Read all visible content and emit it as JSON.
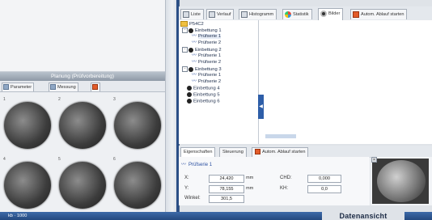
{
  "left_panel": {
    "header": "Planung (Prüfvorbereitung)",
    "tabs": [
      {
        "label": "Parameter",
        "icon": "parameter-icon"
      },
      {
        "label": "Messung",
        "icon": "measure-icon"
      },
      {
        "label": "",
        "icon": "image-icon"
      }
    ],
    "samples": [
      {
        "index": "1"
      },
      {
        "index": "2"
      },
      {
        "index": "3"
      },
      {
        "index": "4"
      },
      {
        "index": "5"
      },
      {
        "index": "6"
      }
    ]
  },
  "top_right": {
    "tabs": [
      {
        "label": "Liste",
        "icon": "list-icon"
      },
      {
        "label": "Verlauf",
        "icon": "history-icon"
      },
      {
        "label": "Histogramm",
        "icon": "histogram-icon"
      },
      {
        "label": "Statistik",
        "icon": "statistics-icon"
      },
      {
        "label": "Bilder",
        "icon": "images-icon",
        "active": true
      },
      {
        "label": "Autom. Ablauf starten",
        "icon": "autorun-icon"
      }
    ],
    "tree": [
      {
        "label": "P54C2",
        "level": 0,
        "type": "folder"
      },
      {
        "label": "Einbettung 1",
        "level": 1,
        "type": "group",
        "expand": "−"
      },
      {
        "label": "Prüfserie 1",
        "level": 2,
        "type": "series",
        "selected": true
      },
      {
        "label": "Prüfserie 2",
        "level": 2,
        "type": "series"
      },
      {
        "label": "Einbettung 2",
        "level": 1,
        "type": "group",
        "expand": "−"
      },
      {
        "label": "Prüfserie 1",
        "level": 2,
        "type": "series"
      },
      {
        "label": "Prüfserie 2",
        "level": 2,
        "type": "series"
      },
      {
        "label": "Einbettung 3",
        "level": 1,
        "type": "group",
        "expand": "−"
      },
      {
        "label": "Prüfserie 1",
        "level": 2,
        "type": "series"
      },
      {
        "label": "Prüfserie 2",
        "level": 2,
        "type": "series"
      },
      {
        "label": "Einbettung 4",
        "level": 1,
        "type": "group"
      },
      {
        "label": "Einbettung 5",
        "level": 1,
        "type": "group"
      },
      {
        "label": "Einbettung 6",
        "level": 1,
        "type": "group"
      }
    ]
  },
  "bottom_right": {
    "tabs": [
      {
        "label": "Eigenschaften",
        "active": true
      },
      {
        "label": "Steuerung"
      },
      {
        "label": "Autom. Ablauf starten",
        "icon": "autorun-icon"
      }
    ],
    "selected_item": "Prüfserie 1",
    "fields": {
      "x": {
        "label": "X:",
        "value": "24,420",
        "unit": "mm"
      },
      "y": {
        "label": "Y:",
        "value": "78,155",
        "unit": "mm"
      },
      "winkel": {
        "label": "Winkel:",
        "value": "301,5"
      },
      "chd": {
        "label": "CHD:",
        "value": "0,000"
      },
      "kh": {
        "label": "KH:",
        "value": "0,0"
      }
    }
  },
  "status_bar": {
    "left_text": "kb · 1000",
    "title": "Datenansicht"
  },
  "colors": {
    "accent_blue": "#2b4f86",
    "tab_orange": "#e35c2a"
  }
}
